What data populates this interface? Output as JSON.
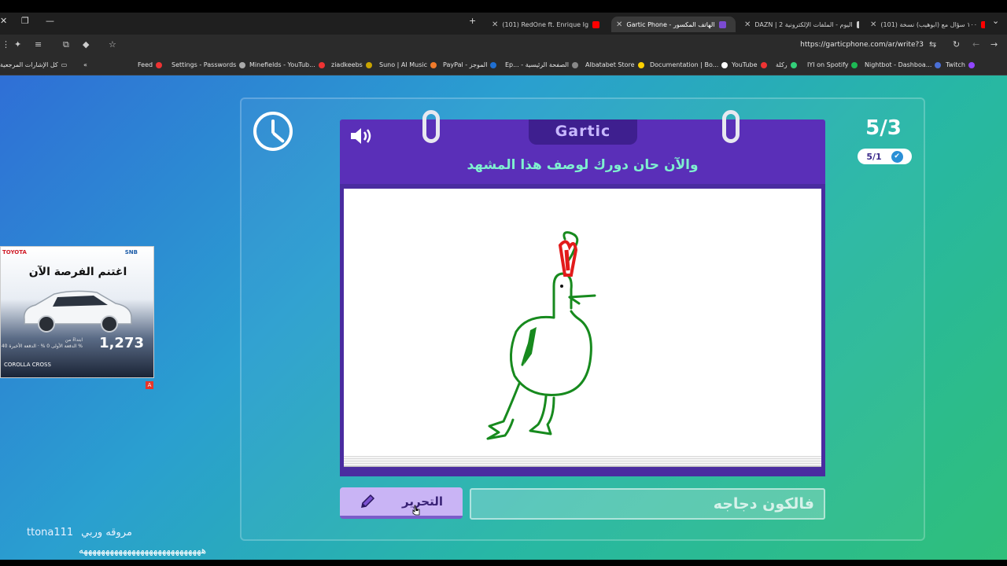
{
  "browser": {
    "tabs": [
      {
        "label": "Gartic Phone - الهاتف المكسور",
        "active": true,
        "favicon_color": "#7b4bd1"
      },
      {
        "label": "(101) RedOne ft. Enrique Ig",
        "active": false,
        "favicon_color": "#ff0000"
      },
      {
        "label": "DAZN | 2 اليوم - الملفات الإلكترونية",
        "active": false,
        "favicon_color": "#cccccc"
      },
      {
        "label": "(101) ١٠٠ سؤال مع (ابوهيب) نسخة",
        "active": false,
        "favicon_color": "#ff0000"
      }
    ],
    "url": "https://garticphone.com/ar/write?3",
    "bookmarks": [
      {
        "label": "Feed",
        "color": "#e33"
      },
      {
        "label": "Settings - Passwords",
        "color": "#aaa"
      },
      {
        "label": "Minefields - YouTub...",
        "color": "#e33"
      },
      {
        "label": "ziadkeebs",
        "color": "#c9a400"
      },
      {
        "label": "Suno | AI Music",
        "color": "#f07b2b"
      },
      {
        "label": "PayPal - الموجز",
        "color": "#1f6fd1"
      },
      {
        "label": "Ep... - الصفحة الرئيسية",
        "color": "#888"
      },
      {
        "label": "Albatabet Store",
        "color": "#ffd000"
      },
      {
        "label": "Documentation | Bo...",
        "color": "#fff"
      },
      {
        "label": "YouTube",
        "color": "#e33"
      },
      {
        "label": "ركلة",
        "color": "#33d17a"
      },
      {
        "label": "IYI on Spotify",
        "color": "#1db954"
      },
      {
        "label": "Nightbot - Dashboa...",
        "color": "#4a6fd6"
      },
      {
        "label": "Twitch",
        "color": "#9146ff"
      }
    ],
    "bookmarks_folder": "كل الإشارات المرجعية"
  },
  "game": {
    "logo": "Gartic",
    "prompt": "والآن حان دورك لوصف هذا المشهد",
    "round_counter": "5/3",
    "progress_badge": "5/1",
    "edit_button": "التحرير",
    "answer_value": "فالكون دجاجه"
  },
  "ad": {
    "brand": "TOYOTA",
    "sponsor": "SNB",
    "headline": "اغتنم الفرصة الآن",
    "price": "1,273",
    "price_prefix": "ابتداءً من",
    "details": "الدفعة الأولى 0 % · الدفعة الأخيرة 40 %",
    "model": "COROLLA CROSS"
  },
  "overlay": {
    "username": "ttona111",
    "user_message": "مروقه وربي",
    "spam_line": "ههههههههههههههههههههههههههههه"
  }
}
